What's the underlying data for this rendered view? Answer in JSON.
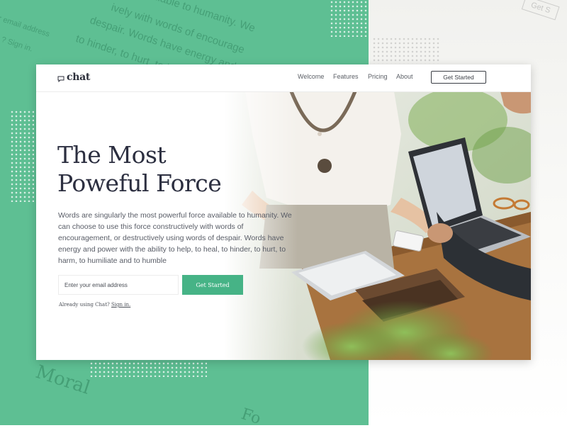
{
  "background": {
    "ghost_lines": [
      "ively with words of encourage",
      "despair. Words have energy and",
      "to hinder, to hurt, to harm, to"
    ],
    "ghost_left_lines": [
      "r email address",
      "? Sign in."
    ],
    "ghost_top": "available to humanity. We",
    "ghost_words": [
      "Moral",
      "Fo"
    ],
    "ghost_cta": "Get S"
  },
  "nav": {
    "logo": "chat",
    "links": [
      "Welcome",
      "Features",
      "Pricing",
      "About"
    ],
    "cta": "Get Started"
  },
  "hero": {
    "title_line1": "The Most",
    "title_line2": "Poweful Force",
    "description": "Words are singularly the most powerful force available to humanity. We can choose to use this force constructively with words of encouragement, or destructively using words of despair. Words have energy and power with the ability to help, to heal, to hinder, to hurt, to harm, to humiliate and to humble",
    "email_placeholder": "Enter your email address",
    "signup_button": "Get Started",
    "signin_prompt": "Already using Chat?",
    "signin_link": "Sign in."
  },
  "colors": {
    "brand_green": "#46b386",
    "background_green": "#5ebf93",
    "title_navy": "#2c2f40"
  }
}
